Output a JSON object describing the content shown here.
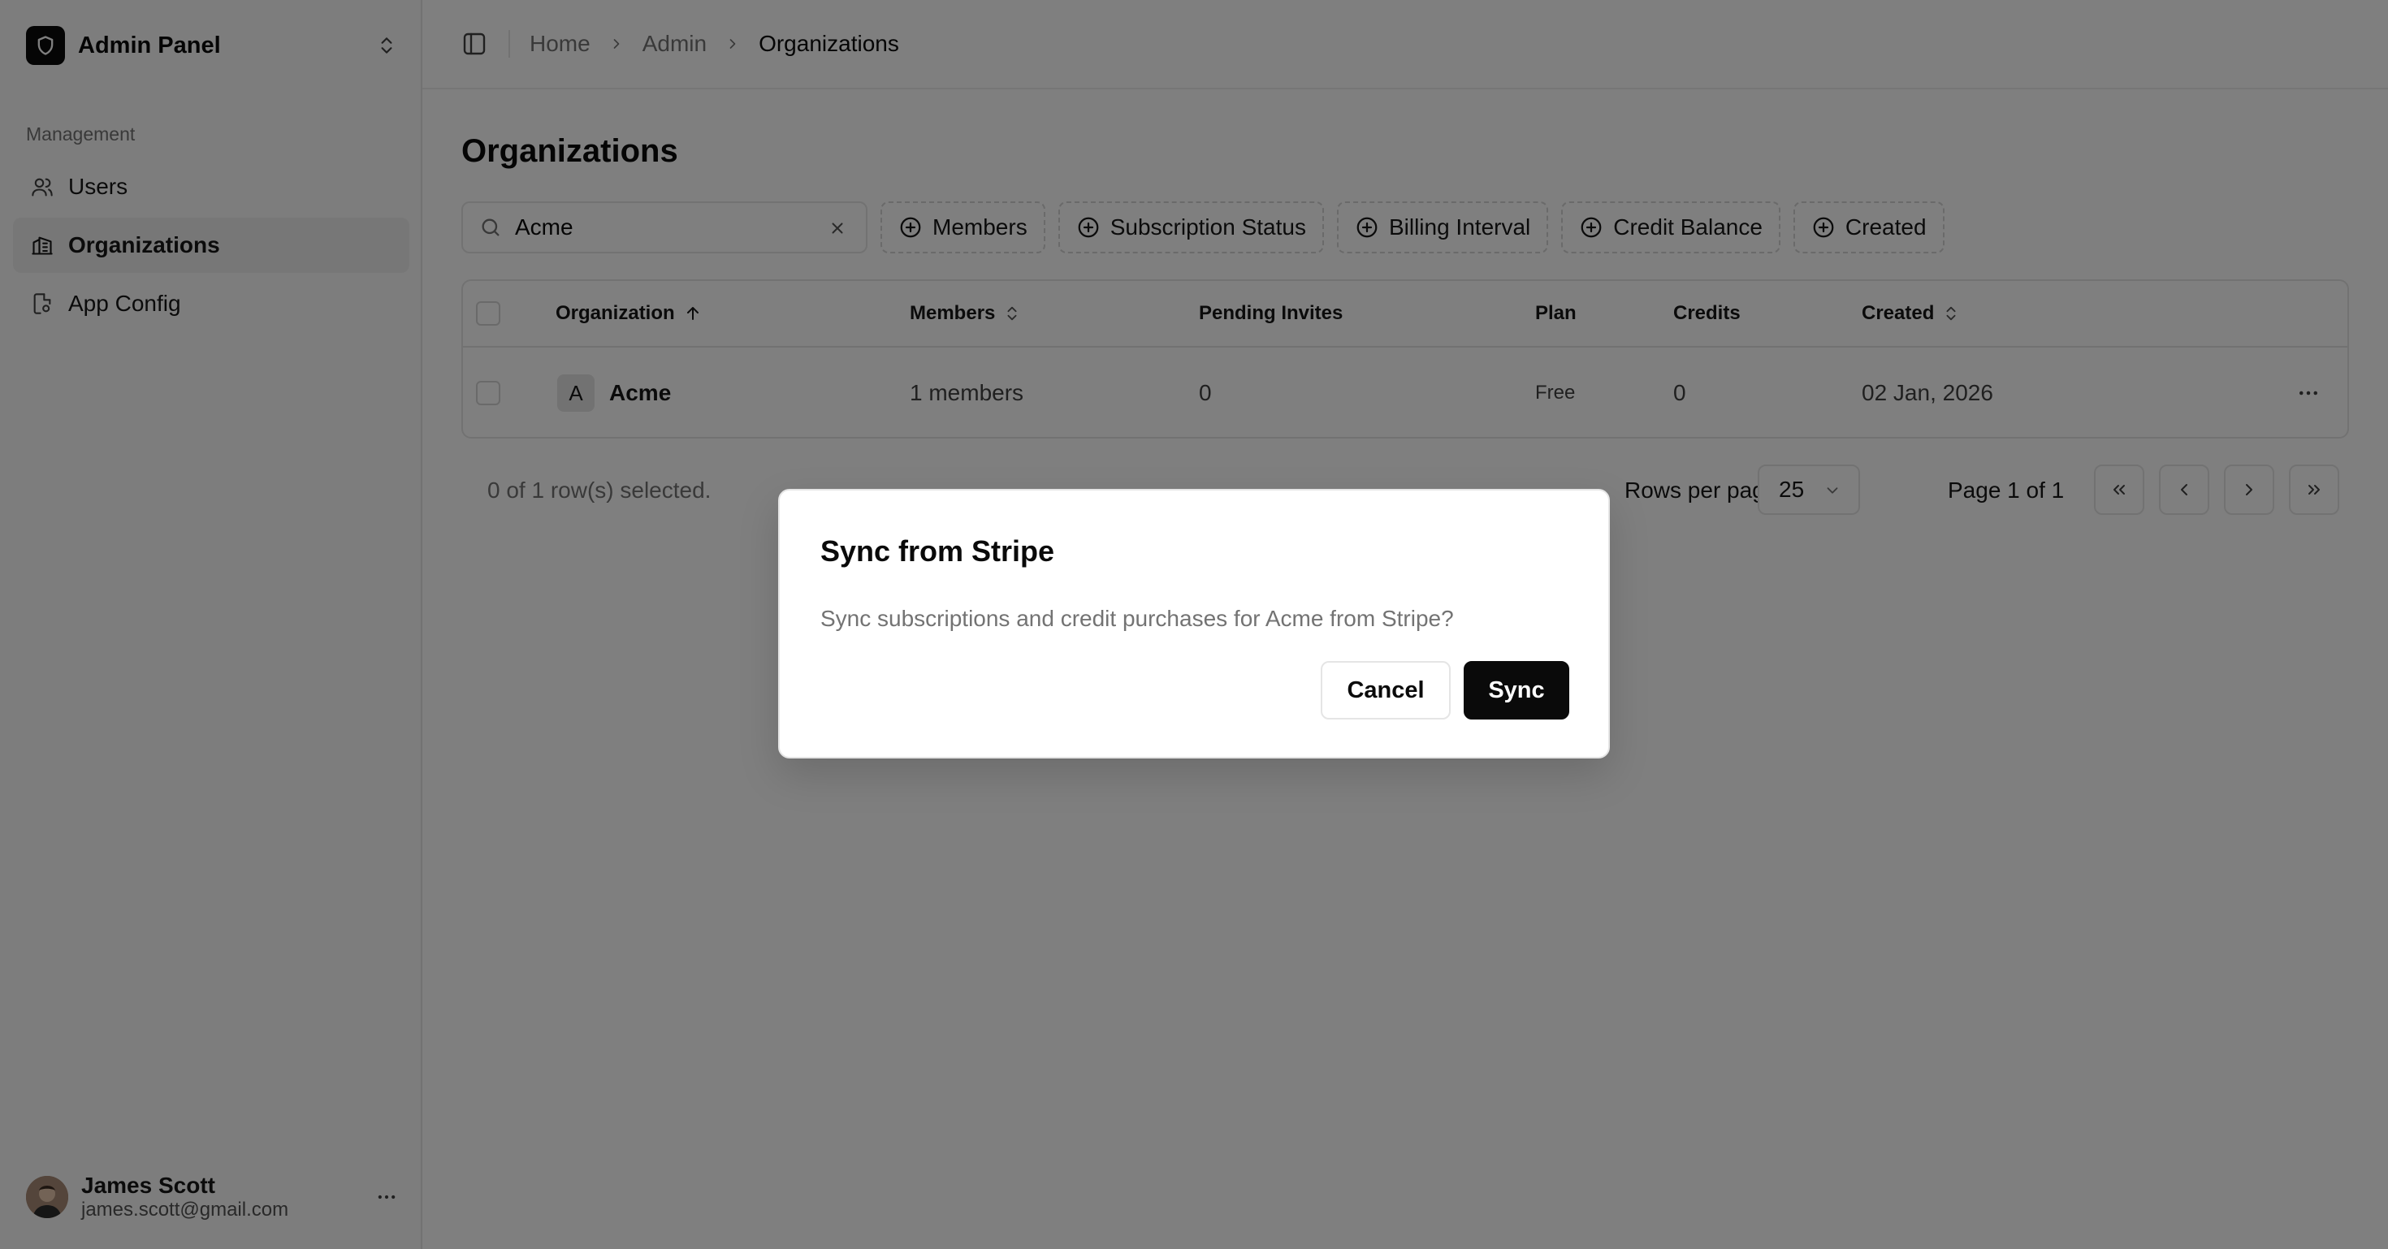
{
  "sidebar": {
    "brand": {
      "name": "Admin Panel",
      "icon": "shield-icon"
    },
    "section_label": "Management",
    "items": [
      {
        "label": "Users",
        "icon": "users-icon",
        "active": false
      },
      {
        "label": "Organizations",
        "icon": "building-icon",
        "active": true
      },
      {
        "label": "App Config",
        "icon": "file-cog-icon",
        "active": false
      }
    ],
    "user": {
      "name": "James Scott",
      "email": "james.scott@gmail.com"
    }
  },
  "breadcrumb": [
    "Home",
    "Admin",
    "Organizations"
  ],
  "page": {
    "title": "Organizations"
  },
  "filters": {
    "search_value": "Acme",
    "chips": [
      "Members",
      "Subscription Status",
      "Billing Interval",
      "Credit Balance",
      "Created"
    ]
  },
  "table": {
    "headers": {
      "organization": "Organization",
      "members": "Members",
      "pending_invites": "Pending Invites",
      "plan": "Plan",
      "credits": "Credits",
      "created": "Created"
    },
    "rows": [
      {
        "badge": "A",
        "organization": "Acme",
        "members": "1 members",
        "pending_invites": "0",
        "plan": "Free",
        "credits": "0",
        "created": "02 Jan, 2026"
      }
    ]
  },
  "footer": {
    "selected_text": "0 of 1 row(s) selected.",
    "rows_per_page_label": "Rows per page",
    "rows_per_page_value": "25",
    "page_text": "Page 1 of 1"
  },
  "dialog": {
    "title": "Sync from Stripe",
    "description": "Sync subscriptions and credit purchases for Acme from Stripe?",
    "cancel_label": "Cancel",
    "confirm_label": "Sync"
  },
  "colors": {
    "primary": "#0a0a0a",
    "muted_text": "#737373",
    "border": "#e5e5e5",
    "overlay": "rgba(0,0,0,0.5)"
  }
}
